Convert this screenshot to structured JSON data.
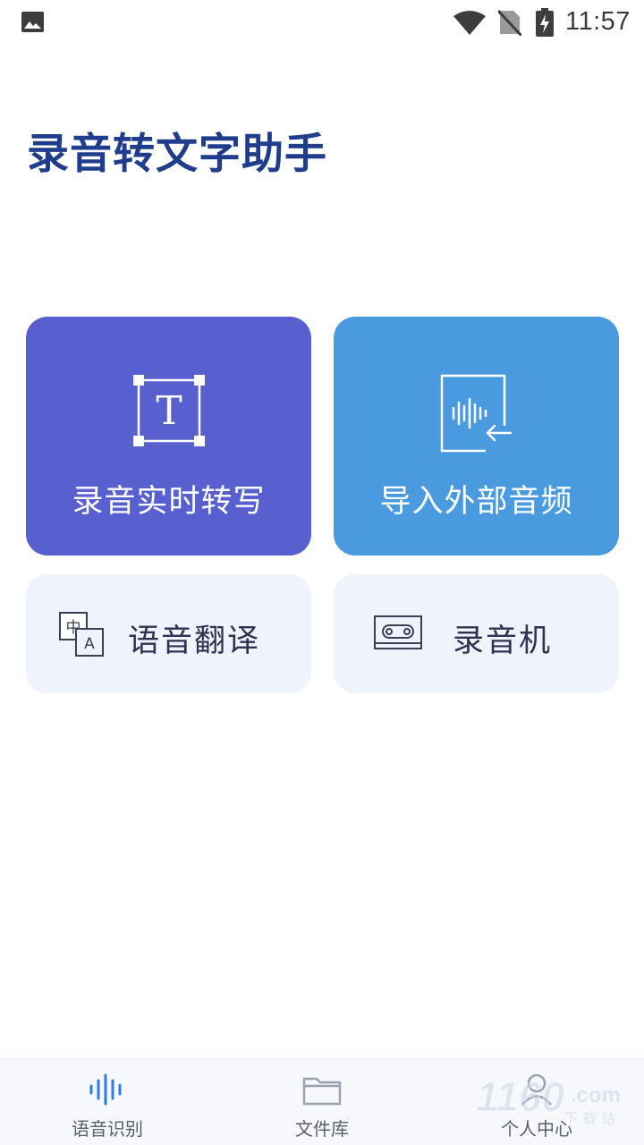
{
  "status_bar": {
    "time": "11:57",
    "icons": [
      "image-icon",
      "wifi-icon",
      "no-sim-icon",
      "battery-charging-icon"
    ]
  },
  "app": {
    "title": "录音转文字助手"
  },
  "cards": {
    "record": {
      "label": "录音实时转写",
      "icon": "text-frame-icon",
      "color": "#585fcf"
    },
    "import": {
      "label": "导入外部音频",
      "icon": "audio-import-icon",
      "color": "#4a9ae0"
    },
    "translate": {
      "label": "语音翻译",
      "icon": "translate-icon"
    },
    "recorder": {
      "label": "录音机",
      "icon": "cassette-icon"
    }
  },
  "bottom_nav": {
    "items": [
      {
        "label": "语音识别",
        "icon": "waveform-icon",
        "active": true,
        "color": "#2f7de1"
      },
      {
        "label": "文件库",
        "icon": "folder-icon",
        "active": false
      },
      {
        "label": "个人中心",
        "icon": "person-icon",
        "active": false
      }
    ]
  },
  "watermark": {
    "text": "1160",
    "sub": "下载站",
    "domain": ".com"
  }
}
